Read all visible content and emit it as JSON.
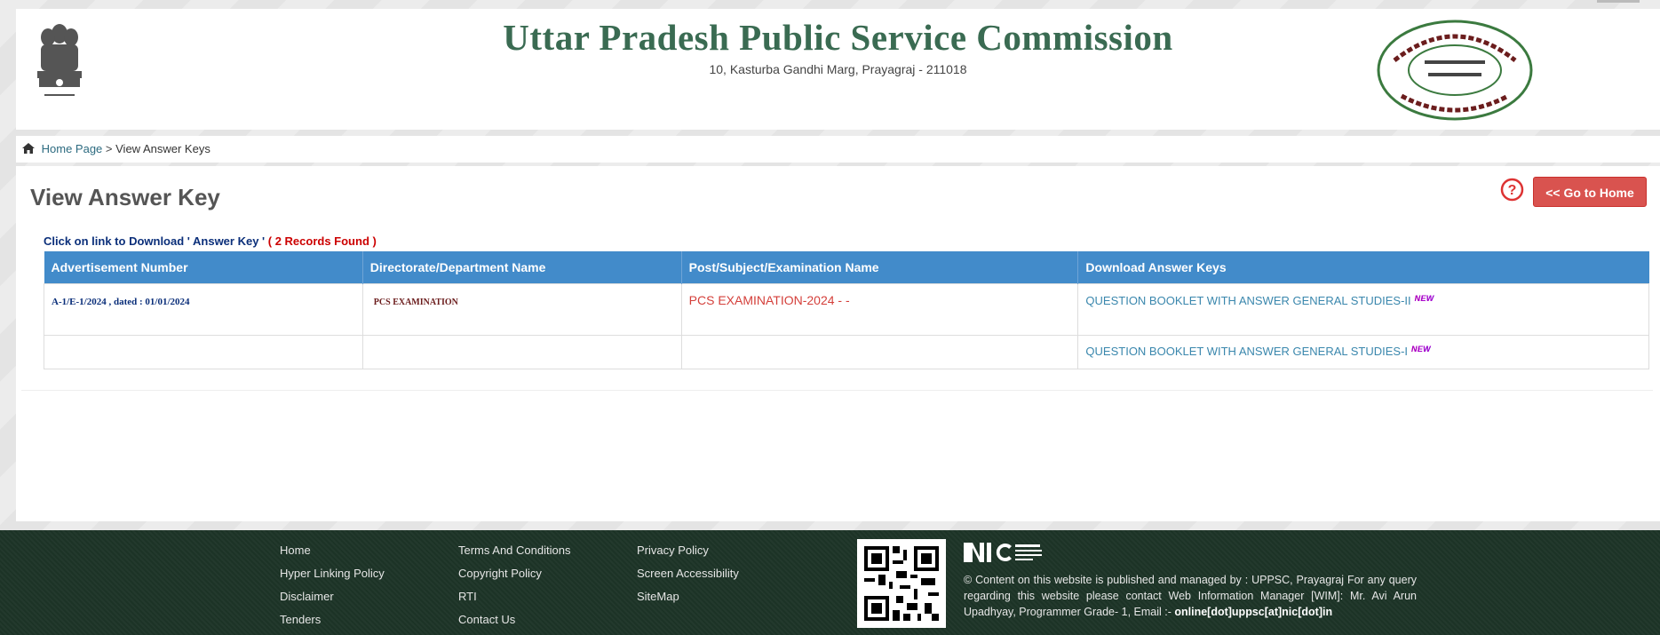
{
  "header": {
    "title": "Uttar Pradesh Public Service Commission",
    "address": "10, Kasturba Gandhi Marg, Prayagraj - 211018"
  },
  "breadcrumb": {
    "home": "Home Page",
    "separator": ">",
    "current": "View Answer Keys"
  },
  "main": {
    "heading": "View Answer Key",
    "go_home_label": "<< Go to Home",
    "click_info": "Click on link to Download ' Answer Key '",
    "records_found": "( 2 Records Found )"
  },
  "table": {
    "columns": [
      "Advertisement Number",
      "Directorate/Department Name",
      "Post/Subject/Examination Name",
      "Download Answer Keys"
    ],
    "rows": [
      {
        "advertisement": "A-1/E-1/2024 , dated : 01/01/2024",
        "department": "PCS EXAMINATION",
        "post": "PCS EXAMINATION-2024 - -",
        "download": "QUESTION BOOKLET WITH ANSWER GENERAL STUDIES-II",
        "badge": "NEW"
      },
      {
        "advertisement": "",
        "department": "",
        "post": "",
        "download": "QUESTION BOOKLET WITH ANSWER GENERAL STUDIES-I",
        "badge": "NEW"
      }
    ]
  },
  "footer": {
    "col1": [
      "Home",
      "Hyper Linking Policy",
      "Disclaimer",
      "Tenders"
    ],
    "col2": [
      "Terms And Conditions",
      "Copyright Policy",
      "RTI",
      "Contact Us"
    ],
    "col3": [
      "Privacy Policy",
      "Screen Accessibility",
      "SiteMap"
    ],
    "content_text": "© Content on this website is published and managed by : UPPSC, Prayagraj For any query regarding this website please contact Web Information Manager [WIM]: Mr. Avi Arun Upadhyay, Programmer Grade- 1, Email :-",
    "email": "online[dot]uppsc[at]nic[dot]in"
  },
  "colors": {
    "title_green": "#3a6b52",
    "table_header": "#428bca",
    "button_red": "#d9534f",
    "footer_bg": "#1c3326"
  },
  "icons": [
    "home-icon",
    "help-icon",
    "emblem-logo",
    "uppsc-seal-logo",
    "qr-code",
    "nic-logo"
  ]
}
